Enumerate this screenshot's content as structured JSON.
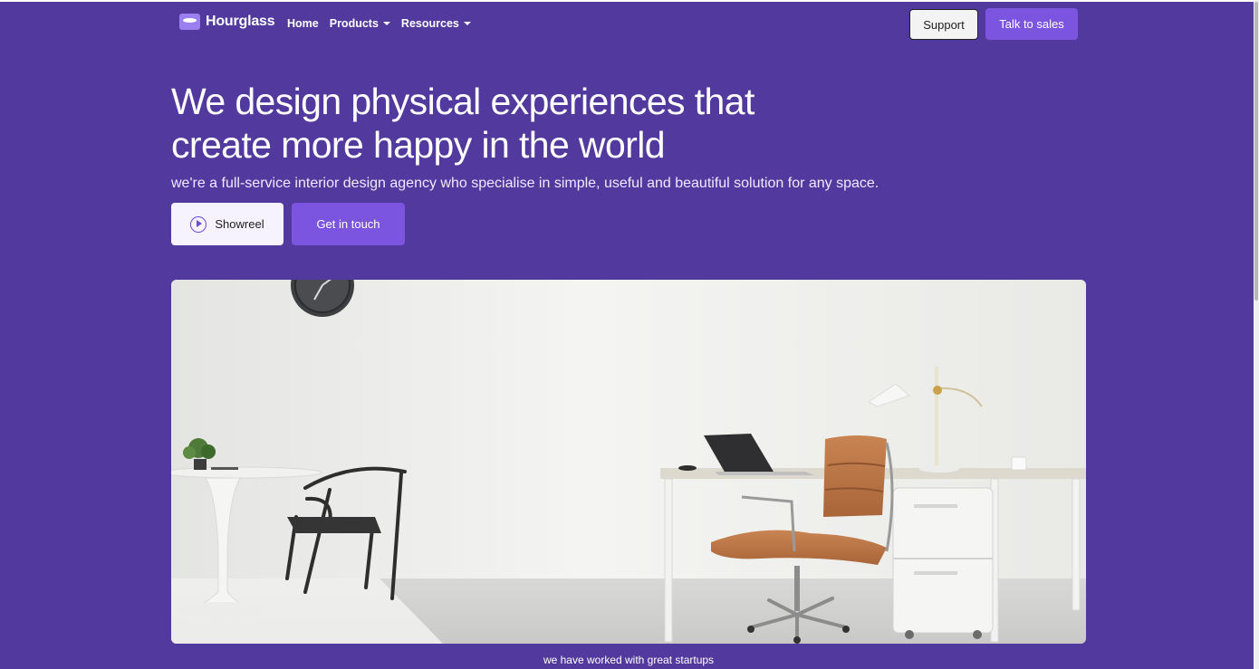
{
  "nav": {
    "brand": "Hourglass",
    "links": [
      {
        "label": "Home",
        "dropdown": false
      },
      {
        "label": "Products",
        "dropdown": true
      },
      {
        "label": "Resources",
        "dropdown": true
      }
    ],
    "support_label": "Support",
    "sales_label": "Talk to sales"
  },
  "hero": {
    "title_line1": "We design physical experiences that",
    "title_line2": "create more happy in the world",
    "subtitle": "we're a full-service interior design agency who specialise in simple, useful and beautiful solution for any space.",
    "showreel_label": "Showreel",
    "contact_label": "Get in touch"
  },
  "caption": "we have worked with great startups",
  "colors": {
    "background": "#52399e",
    "accent": "#7b55e0",
    "light_button": "#f6f3ff"
  },
  "icons": [
    "hourglass-logo-icon",
    "caret-down-icon",
    "play-circle-icon"
  ]
}
